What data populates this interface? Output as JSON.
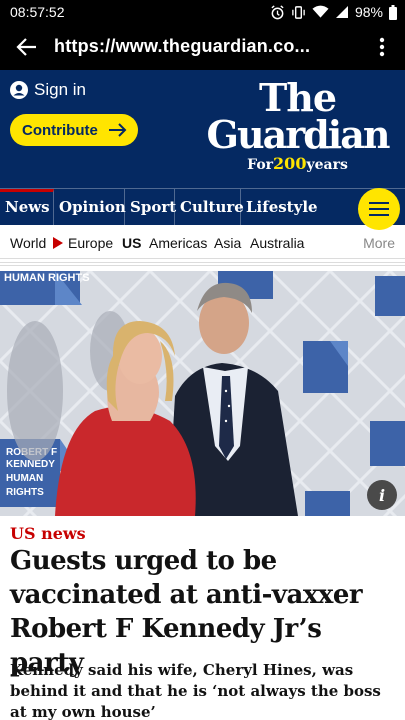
{
  "status_bar": {
    "time": "08:57:52",
    "battery": "98%"
  },
  "browser": {
    "url": "https://www.theguardian.co..."
  },
  "masthead": {
    "sign_in": "Sign in",
    "contribute": "Contribute",
    "logo_line1": "The",
    "logo_line2": "Guardian",
    "logo_for": "For",
    "logo_num": "200",
    "logo_years": "years"
  },
  "pillars": [
    "News",
    "Opinion",
    "Sport",
    "Culture",
    "Lifestyle"
  ],
  "subnav": {
    "world": "World",
    "europe": "Europe",
    "us": "US",
    "americas": "Americas",
    "asia": "Asia",
    "australia": "Australia",
    "more": "More"
  },
  "article": {
    "kicker": "US news",
    "headline": "Guests urged to be vaccinated at anti-vaxxer Robert F Kennedy Jr’s party",
    "standfirst": "Kennedy said his wife, Cheryl Hines, was behind it and that he is ‘not always the boss at my own house’"
  },
  "photo": {
    "backdrop_top": "HUMAN RIGHTS",
    "backdrop_bottom": "ROBERT F KENNEDY HUMAN RIGHTS",
    "info_label": "i"
  },
  "colors": {
    "guardian_blue": "#052962",
    "guardian_yellow": "#ffe500",
    "news_red": "#c70000"
  }
}
